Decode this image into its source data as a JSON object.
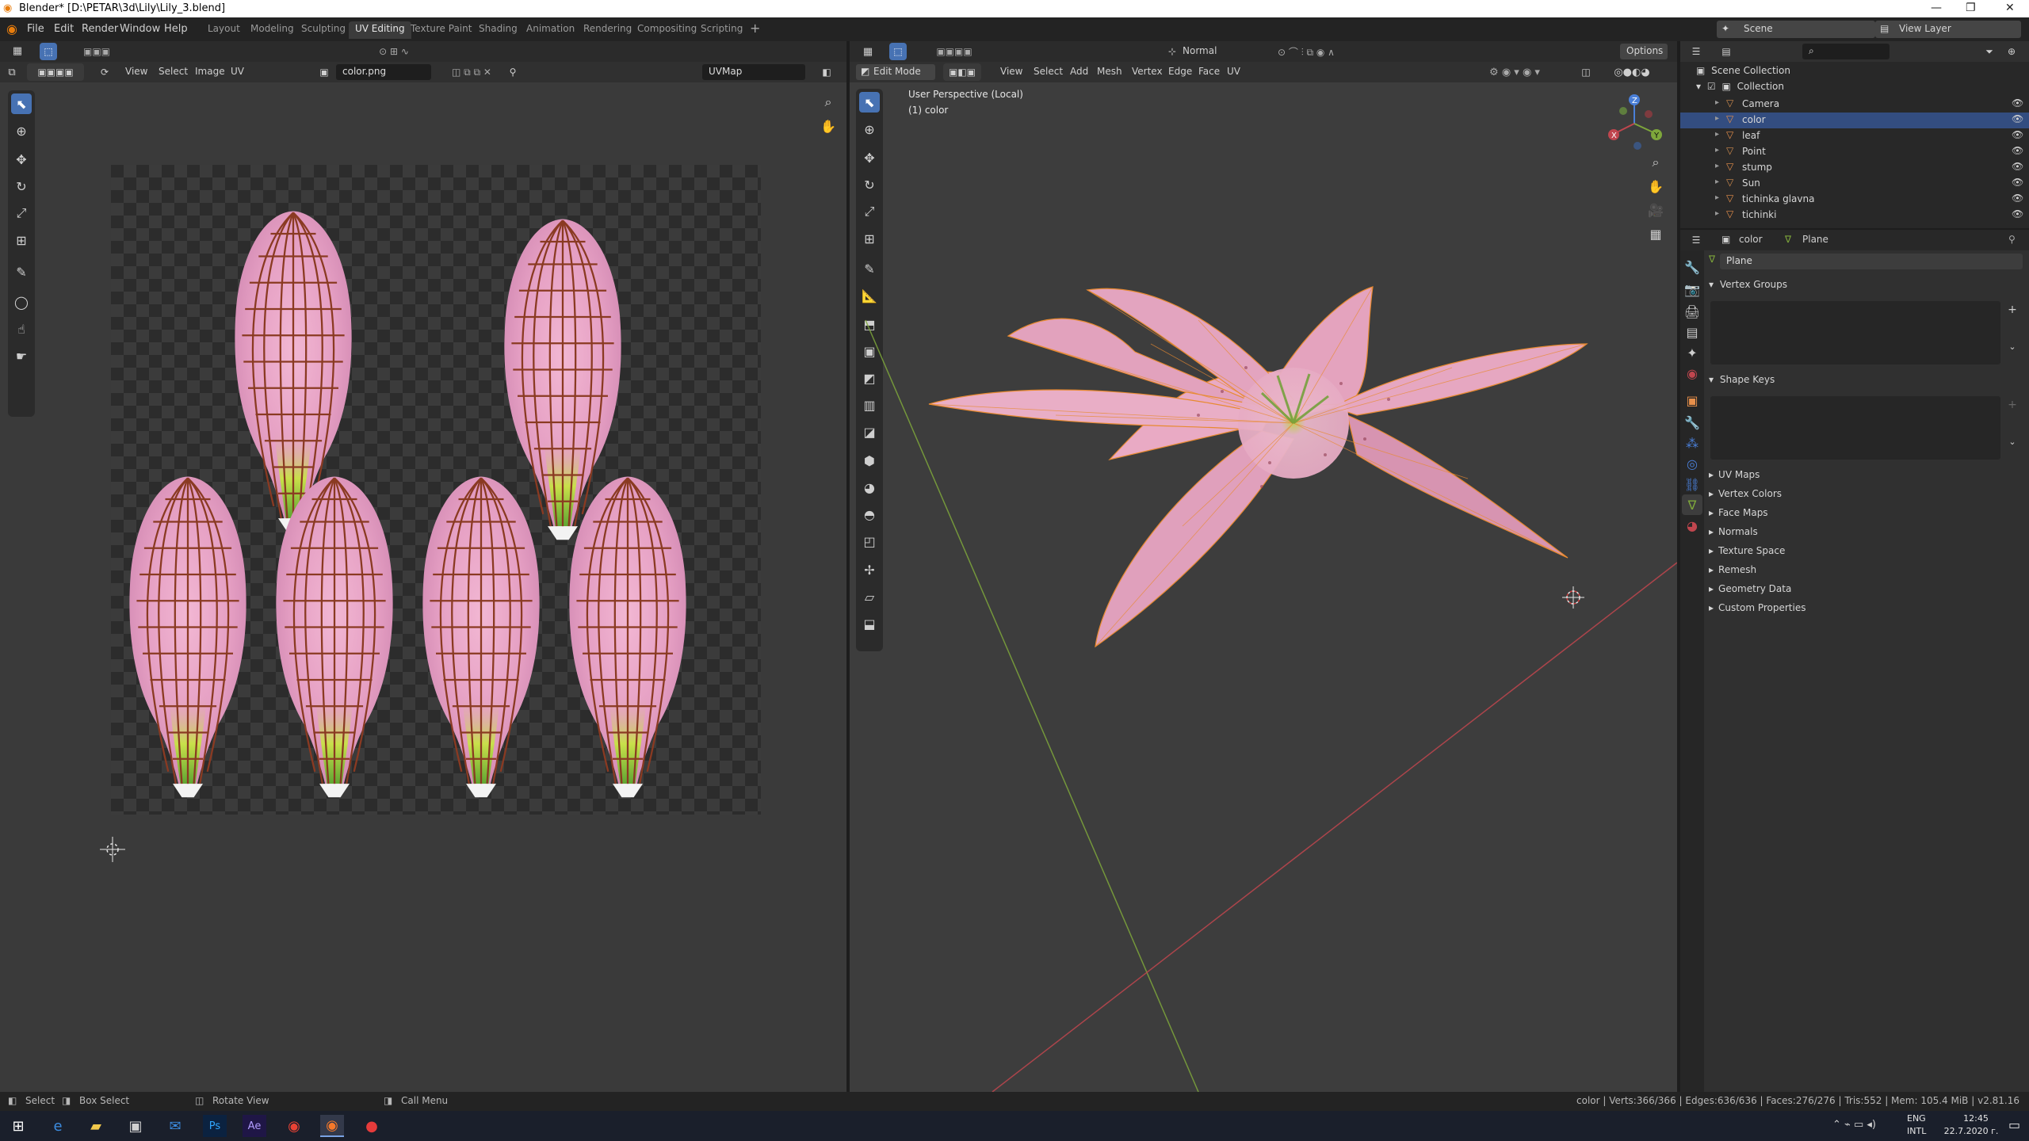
{
  "window": {
    "title": "Blender* [D:\\PETAR\\3d\\Lily\\Lily_3.blend]",
    "controls": [
      "—",
      "❐",
      "✕"
    ]
  },
  "menus": [
    "File",
    "Edit",
    "Render",
    "Window",
    "Help"
  ],
  "workspaces": [
    "Layout",
    "Modeling",
    "Sculpting",
    "UV Editing",
    "Texture Paint",
    "Shading",
    "Animation",
    "Rendering",
    "Compositing",
    "Scripting"
  ],
  "active_workspace": "UV Editing",
  "scene": {
    "label": "Scene",
    "view_layer": "View Layer"
  },
  "uv_editor": {
    "menus": [
      "View",
      "Select",
      "Image",
      "UV"
    ],
    "image_name": "color.png",
    "uvmap": "UVMap"
  },
  "viewport": {
    "mode": "Edit Mode",
    "menus": [
      "View",
      "Select",
      "Add",
      "Mesh",
      "Vertex",
      "Edge",
      "Face",
      "UV"
    ],
    "orientation": "Normal",
    "options": "Options",
    "overlay_line1": "User Perspective (Local)",
    "overlay_line2": "(1) color",
    "gizmo_axes": [
      "Z",
      "Y",
      "X"
    ]
  },
  "outliner": {
    "root": "Scene Collection",
    "collection": "Collection",
    "items": [
      {
        "name": "Camera",
        "icon_color": "#d18c4d"
      },
      {
        "name": "color",
        "icon_color": "#e8904b",
        "selected": true
      },
      {
        "name": "leaf",
        "icon_color": "#e8904b"
      },
      {
        "name": "Point",
        "icon_color": "#d18c4d"
      },
      {
        "name": "stump",
        "icon_color": "#e8904b"
      },
      {
        "name": "Sun",
        "icon_color": "#d18c4d"
      },
      {
        "name": "tichinka glavna",
        "icon_color": "#e8904b"
      },
      {
        "name": "tichinki",
        "icon_color": "#e8904b"
      }
    ]
  },
  "properties": {
    "object": "color",
    "mesh": "Plane",
    "mesh_field": "Plane",
    "sections_open": [
      "Vertex Groups",
      "Shape Keys"
    ],
    "sections_closed": [
      "UV Maps",
      "Vertex Colors",
      "Face Maps",
      "Normals",
      "Texture Space",
      "Remesh",
      "Geometry Data",
      "Custom Properties"
    ]
  },
  "status": {
    "left": [
      "Select",
      "Box Select",
      "Rotate View",
      "Call Menu"
    ],
    "right": "color | Verts:366/366 | Edges:636/636 | Faces:276/276 | Tris:552 | Mem: 105.4 MiB | v2.81.16"
  },
  "taskbar": {
    "lang1": "ENG",
    "lang2": "INTL",
    "time": "12:45",
    "date": "22.7.2020 г."
  },
  "colors": {
    "accent": "#4772b3",
    "petal_pink": "#e4a4c4",
    "uv_line": "#8a3a22",
    "x_axis": "#c0464e",
    "y_axis": "#7ea73b",
    "z_axis": "#4a7fd8",
    "orange_edges": "#e88a30"
  }
}
